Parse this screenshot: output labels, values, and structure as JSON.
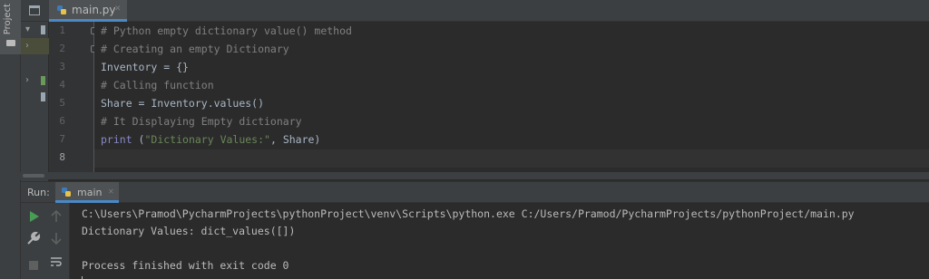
{
  "sidebar": {
    "project_label": "Project"
  },
  "editor": {
    "tab_label": "main.py",
    "line_numbers": [
      "1",
      "2",
      "3",
      "4",
      "5",
      "6",
      "7",
      "8"
    ],
    "lines": {
      "l1": "# Python empty dictionary value() method",
      "l2": "# Creating an empty Dictionary",
      "l3": "Inventory = {}",
      "l4": "# Calling function",
      "l5": "Share = Inventory.values()",
      "l6": "# It Displaying Empty dictionary",
      "l7_print": "print",
      "l7_open": " (",
      "l7_str": "\"Dictionary Values:\"",
      "l7_rest": ", Share)"
    }
  },
  "run": {
    "label": "Run:",
    "tab_label": "main",
    "output": [
      "C:\\Users\\Pramod\\PycharmProjects\\pythonProject\\venv\\Scripts\\python.exe C:/Users/Pramod/PycharmProjects/pythonProject/main.py",
      "Dictionary Values: dict_values([])",
      "",
      "Process finished with exit code 0"
    ]
  },
  "colors": {
    "background": "#2b2b2b",
    "panel": "#3c3f41",
    "comment": "#808080",
    "keyword": "#cc7832",
    "builtin": "#8888c6",
    "string": "#6a8759",
    "text": "#a9b7c6",
    "accent": "#4a88c7",
    "run_green": "#499c54"
  },
  "icons": {
    "tab": "python-file-icon",
    "project": "folder-icon",
    "run": "run-play-icon",
    "wrench": "wrench-icon",
    "stop": "stop-icon",
    "up": "arrow-up-icon",
    "down": "arrow-down-icon",
    "wrap": "soft-wrap-icon"
  }
}
